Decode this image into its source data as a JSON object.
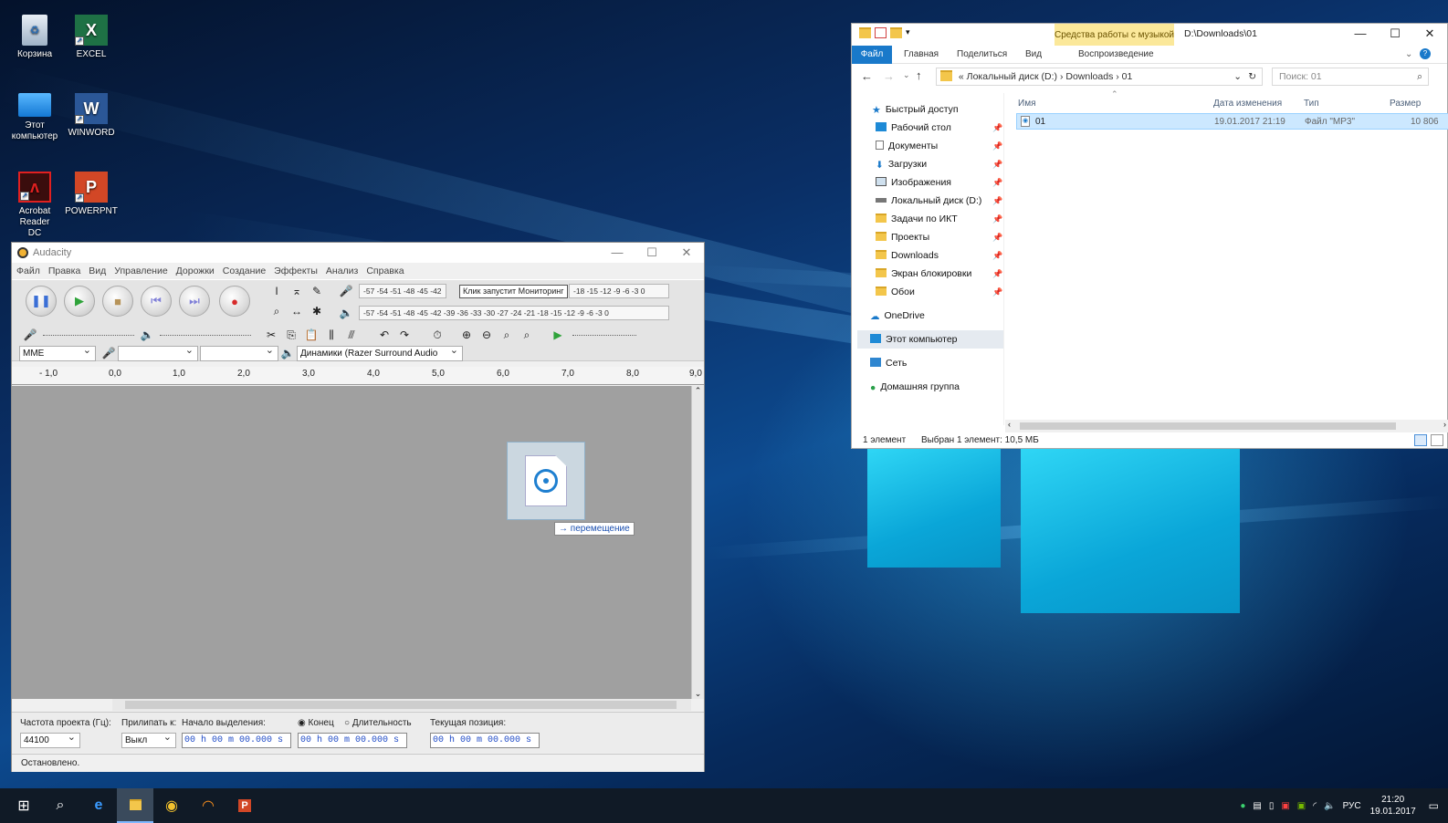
{
  "desktop": {
    "icons": [
      {
        "label": "Корзина"
      },
      {
        "label": "EXCEL"
      },
      {
        "label": "Этот компьютер"
      },
      {
        "label": "WINWORD"
      },
      {
        "label": "Acrobat Reader DC"
      },
      {
        "label": "POWERPNT"
      }
    ]
  },
  "audacity": {
    "title": "Audacity",
    "menu": [
      "Файл",
      "Правка",
      "Вид",
      "Управление",
      "Дорожки",
      "Создание",
      "Эффекты",
      "Анализ",
      "Справка"
    ],
    "meter_record": "-57 -54 -51 -48 -45 -42",
    "meter_record_right": "-18 -15 -12 -9 -6 -3 0",
    "meter_play": "-57 -54 -51 -48 -45 -42 -39 -36 -33 -30 -27 -24 -21 -18 -15 -12 -9 -6 -3 0",
    "tooltip": "Клик запустит Мониторинг",
    "host": "MME",
    "output_device": "Динамики (Razer Surround Audio",
    "ruler": [
      "- 1,0",
      "0,0",
      "1,0",
      "2,0",
      "3,0",
      "4,0",
      "5,0",
      "6,0",
      "7,0",
      "8,0",
      "9,0"
    ],
    "drag_tip": "→ перемещение",
    "rate_label": "Частота проекта (Гц):",
    "rate_value": "44100",
    "snap_label": "Прилипать к:",
    "snap_value": "Выкл",
    "sel_start_label": "Начало выделения:",
    "radio_end": "Конец",
    "radio_length": "Длительность",
    "position_label": "Текущая позиция:",
    "time_value": "00 h 00 m 00.000 s",
    "status": "Остановлено."
  },
  "explorer": {
    "context_tab": "Средства работы с музыкой",
    "path_title": "D:\\Downloads\\01",
    "ribbon": {
      "file": "Файл",
      "home": "Главная",
      "share": "Поделиться",
      "view": "Вид",
      "playback": "Воспроизведение"
    },
    "address": "«  Локальный диск (D:)  ›  Downloads  ›  01",
    "search_placeholder": "Поиск: 01",
    "nav": {
      "quick_access": "Быстрый доступ",
      "pinned": [
        "Рабочий стол",
        "Документы",
        "Загрузки",
        "Изображения",
        "Локальный диск (D:)",
        "Задачи по ИКТ",
        "Проекты",
        "Downloads",
        "Экран блокировки",
        "Обои"
      ],
      "onedrive": "OneDrive",
      "this_pc": "Этот компьютер",
      "network": "Сеть",
      "homegroup": "Домашняя группа"
    },
    "columns": {
      "name": "Имя",
      "date": "Дата изменения",
      "type": "Тип",
      "size": "Размер"
    },
    "files": [
      {
        "name": "01",
        "date": "19.01.2017 21:19",
        "type": "Файл \"MP3\"",
        "size": "10 806"
      }
    ],
    "status_count": "1 элемент",
    "status_selected": "Выбран 1 элемент: 10,5 МБ"
  },
  "taskbar": {
    "lang": "РУС",
    "time": "21:20",
    "date": "19.01.2017"
  }
}
